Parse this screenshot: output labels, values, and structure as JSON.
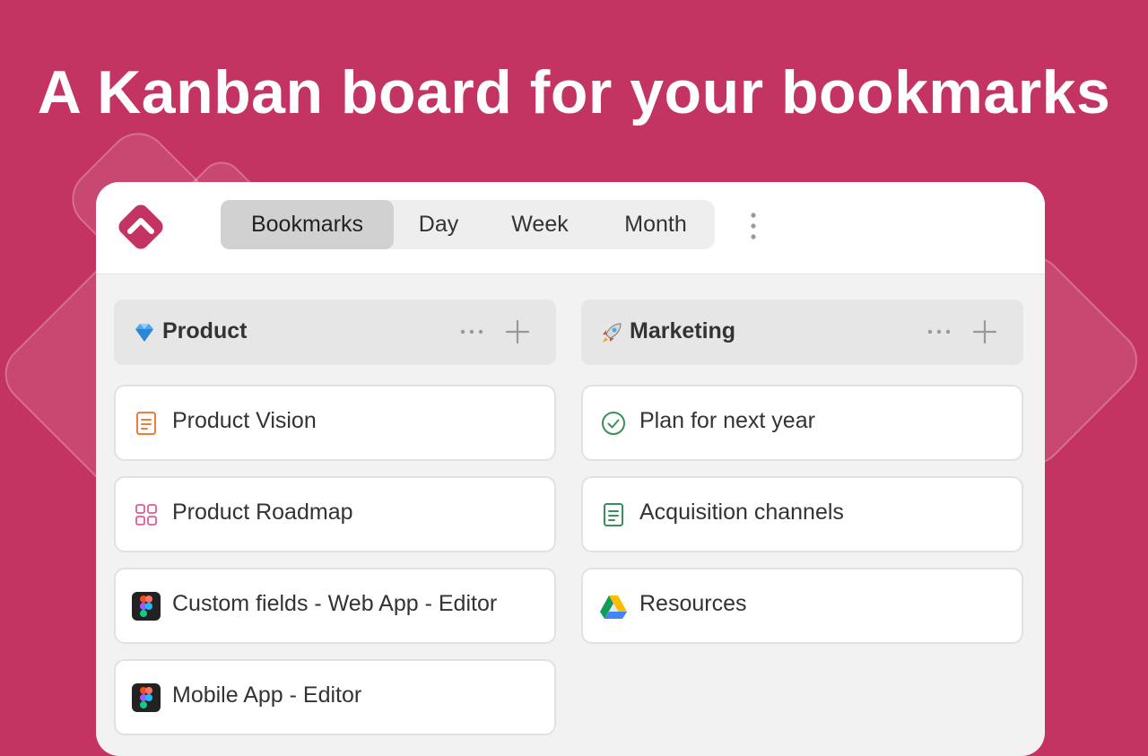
{
  "headline": "A Kanban board for your bookmarks",
  "app": {
    "tabs": [
      {
        "label": "Bookmarks",
        "active": true
      },
      {
        "label": "Day",
        "active": false
      },
      {
        "label": "Week",
        "active": false
      },
      {
        "label": "Month",
        "active": false
      }
    ]
  },
  "columns": [
    {
      "title": "Product",
      "emoji_icon": "gem-icon",
      "cards": [
        {
          "label": "Product Vision",
          "icon": "document-icon"
        },
        {
          "label": "Product Roadmap",
          "icon": "grid-icon"
        },
        {
          "label": "Custom fields - Web App - Editor",
          "icon": "figma-icon"
        },
        {
          "label": "Mobile App - Editor",
          "icon": "figma-icon"
        }
      ]
    },
    {
      "title": "Marketing",
      "emoji_icon": "rocket-icon",
      "cards": [
        {
          "label": "Plan for next year",
          "icon": "check-circle-icon"
        },
        {
          "label": "Acquisition channels",
          "icon": "document-icon"
        },
        {
          "label": "Resources",
          "icon": "google-drive-icon"
        }
      ]
    }
  ],
  "colors": {
    "background": "#c33462",
    "logo": "#c33462",
    "doc_orange": "#f07b3a",
    "grid_pink": "#e05a9a",
    "check_green": "#3a8f5a",
    "doc_green": "#3a8f5a"
  }
}
